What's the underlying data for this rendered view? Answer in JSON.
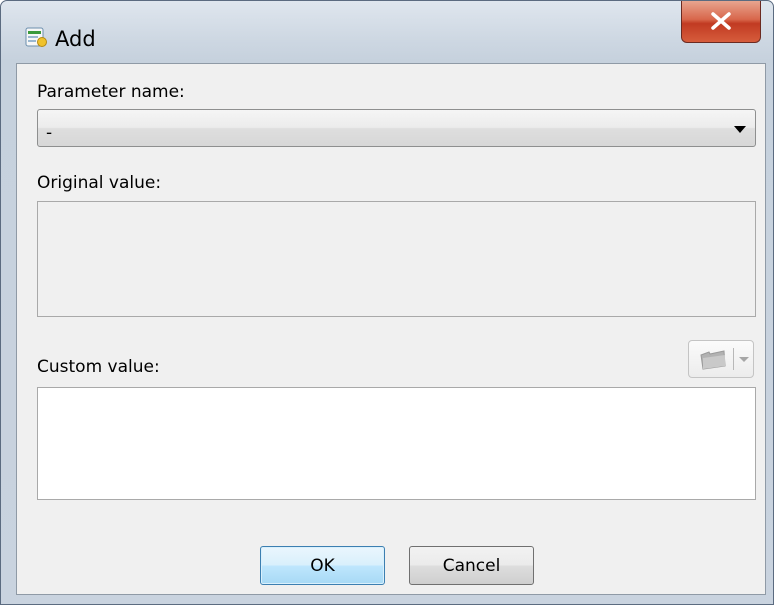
{
  "window": {
    "title": "Add",
    "close_label": "X",
    "icon": "dialog-app-icon"
  },
  "form": {
    "parameter_name_label": "Parameter name:",
    "parameter_name_value": "-",
    "original_value_label": "Original value:",
    "original_value": "",
    "custom_value_label": "Custom value:",
    "custom_value": "",
    "insert_button_icon": "folder-icon"
  },
  "buttons": {
    "ok_label": "OK",
    "cancel_label": "Cancel"
  },
  "colors": {
    "close_button": "#c13a22",
    "ok_button_border": "#3c7fb1"
  }
}
